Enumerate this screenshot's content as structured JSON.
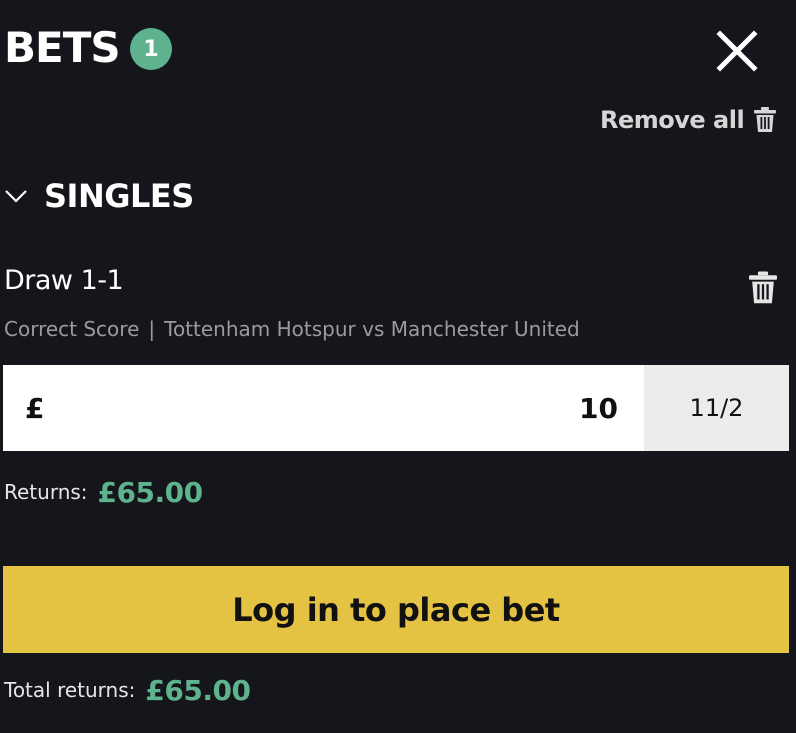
{
  "header": {
    "title": "BETS",
    "count": "1",
    "close_icon": "close-icon"
  },
  "toolbar": {
    "remove_all_label": "Remove all",
    "remove_all_icon": "trash-icon"
  },
  "section": {
    "title": "SINGLES",
    "chevron_icon": "chevron-down-icon"
  },
  "bet": {
    "selection": "Draw 1-1",
    "market": "Correct Score",
    "separator": "|",
    "event": "Tottenham Hotspur vs Manchester United",
    "currency": "£",
    "stake": "10",
    "odds": "11/2",
    "returns_label": "Returns:",
    "returns_value": "£65.00"
  },
  "actions": {
    "place_bet_label": "Log in to place bet"
  },
  "summary": {
    "total_returns_label": "Total returns:",
    "total_returns_value": "£65.00"
  },
  "colors": {
    "background": "#15161b",
    "accent_green": "#5eb38e",
    "cta_yellow": "#e3c244",
    "odds_bg": "#ececec",
    "muted_text": "#9a9ba0"
  }
}
